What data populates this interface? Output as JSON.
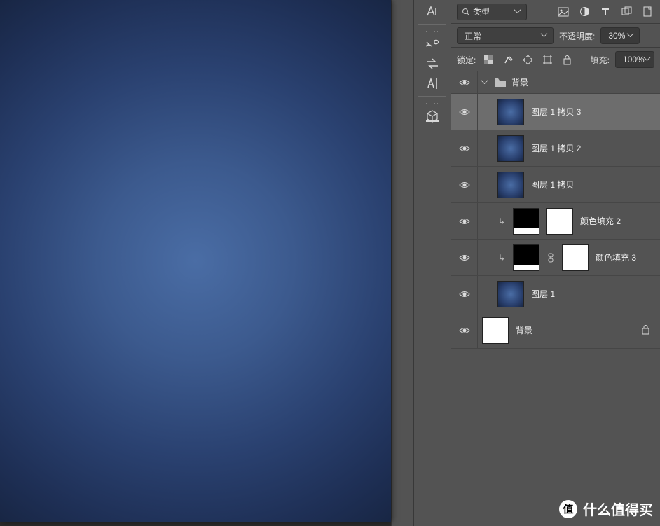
{
  "filter": {
    "placeholder": "类型"
  },
  "blend": {
    "mode": "正常",
    "opacity_label": "不透明度:",
    "opacity_value": "30%"
  },
  "lock": {
    "label": "锁定:",
    "fill_label": "填充:",
    "fill_value": "100%"
  },
  "group": {
    "name": "背景"
  },
  "layers": [
    {
      "name": "图层 1 拷贝 3",
      "thumb": "blue",
      "selected": true
    },
    {
      "name": "图层 1 拷贝 2",
      "thumb": "blue"
    },
    {
      "name": "图层 1 拷贝",
      "thumb": "blue"
    },
    {
      "name": "颜色填充 2",
      "thumb": "grad",
      "clip": true,
      "mask": true
    },
    {
      "name": "颜色填充 3",
      "thumb": "grad",
      "clip": true,
      "mask": true,
      "linked": true
    },
    {
      "name": "图层 1",
      "thumb": "blue",
      "underline": true
    },
    {
      "name": "背景",
      "thumb": "white",
      "locked": true,
      "base": true
    }
  ],
  "watermark": {
    "badge": "值",
    "text": "什么值得买"
  }
}
